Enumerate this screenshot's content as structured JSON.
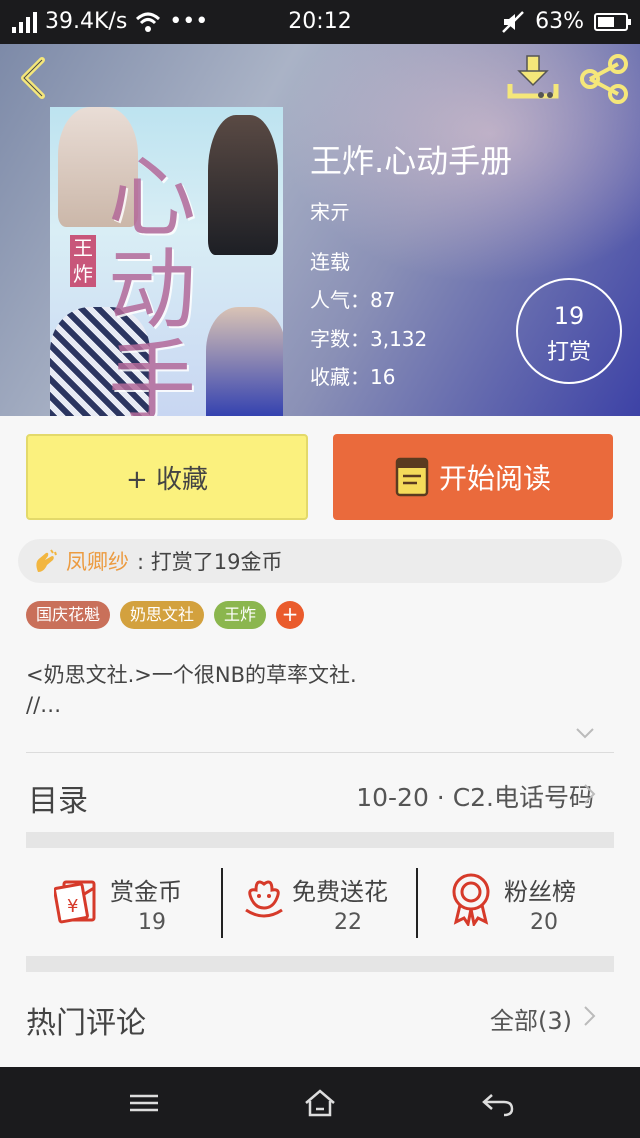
{
  "status_bar": {
    "speed": "39.4K/s",
    "dots": "•••",
    "time": "20:12",
    "battery": "63%",
    "battery_level": 0.63
  },
  "book": {
    "title": "王炸.心动手册",
    "author": "宋亓",
    "status": "连载",
    "popularity": "人气：87",
    "word_count": "字数：3,132",
    "favorites": "收藏：16",
    "tip_count": "19",
    "tip_label": "打赏"
  },
  "cover": {
    "title_art": "心动手册",
    "tag_art": "王炸"
  },
  "actions": {
    "collect_label": "+ 收藏",
    "read_label": "开始阅读"
  },
  "tip_feed": {
    "user": "凤卿纱",
    "message": ": 打赏了19金币"
  },
  "tags": [
    {
      "label": "国庆花魁",
      "color": "#c9705a"
    },
    {
      "label": "奶思文社",
      "color": "#d3a13e"
    },
    {
      "label": "王炸",
      "color": "#8bb64e"
    }
  ],
  "tag_add_label": "+",
  "description": "<奶思文社.>一个很NB的草率文社.\n//…",
  "toc": {
    "label": "目录",
    "latest": "10-20 · C2.电话号码"
  },
  "stats": [
    {
      "label": "赏金币",
      "value": "19",
      "icon": "red-envelope-icon"
    },
    {
      "label": "免费送花",
      "value": "22",
      "icon": "flower-icon"
    },
    {
      "label": "粉丝榜",
      "value": "20",
      "icon": "medal-icon"
    }
  ],
  "comments": {
    "label": "热门评论",
    "all_label": "全部(3)"
  },
  "colors": {
    "accent_orange": "#ea6a3c",
    "collect_yellow": "#fbf17e",
    "icon_red": "#d63a2a",
    "username_orange": "#ec9b40"
  }
}
